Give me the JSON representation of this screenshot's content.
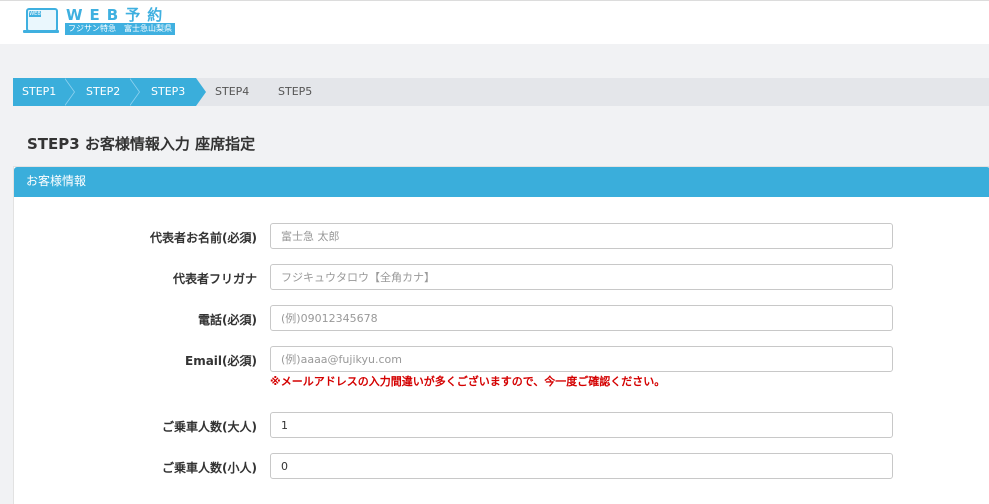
{
  "header": {
    "logo_badge": "WEB",
    "logo_title": "WEB予約",
    "logo_subtitle": "フジサン特急　富士急山梨県"
  },
  "steps": [
    {
      "label": "STEP1",
      "active": true
    },
    {
      "label": "STEP2",
      "active": true
    },
    {
      "label": "STEP3",
      "active": true
    },
    {
      "label": "STEP4",
      "active": false
    },
    {
      "label": "STEP5",
      "active": false
    }
  ],
  "page_title": "STEP3 お客様情報入力 座席指定",
  "panel": {
    "title": "お客様情報",
    "fields": {
      "name": {
        "label": "代表者お名前(必須)",
        "placeholder": "富士急 太郎",
        "value": ""
      },
      "kana": {
        "label": "代表者フリガナ",
        "placeholder": "フジキュウタロウ【全角カナ】",
        "value": ""
      },
      "phone": {
        "label": "電話(必須)",
        "placeholder": "(例)09012345678",
        "value": ""
      },
      "email": {
        "label": "Email(必須)",
        "placeholder": "(例)aaaa@fujikyu.com",
        "value": ""
      },
      "adults": {
        "label": "ご乗車人数(大人)",
        "placeholder": "",
        "value": "1"
      },
      "children": {
        "label": "ご乗車人数(小人)",
        "placeholder": "",
        "value": "0"
      }
    },
    "email_warning": "※メールアドレスの入力間違いが多くございますので、今一度ご確認ください。"
  },
  "colors": {
    "accent": "#3aaedb",
    "warning": "#d40000"
  }
}
